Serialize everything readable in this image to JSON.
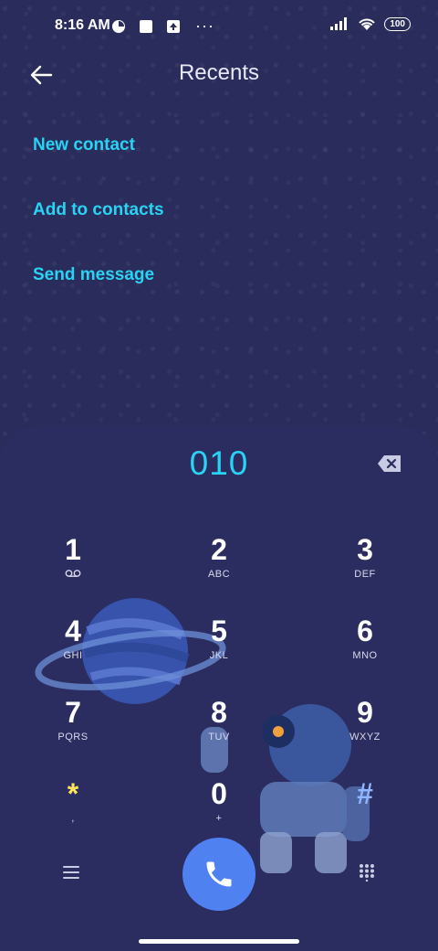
{
  "status_bar": {
    "time": "8:16 AM",
    "battery": "100"
  },
  "header": {
    "title": "Recents"
  },
  "actions": [
    {
      "label": "New contact"
    },
    {
      "label": "Add to contacts"
    },
    {
      "label": "Send message"
    }
  ],
  "dialer": {
    "number": "010",
    "keys": [
      {
        "digit": "1",
        "letters": ""
      },
      {
        "digit": "2",
        "letters": "ABC"
      },
      {
        "digit": "3",
        "letters": "DEF"
      },
      {
        "digit": "4",
        "letters": "GHI"
      },
      {
        "digit": "5",
        "letters": "JKL"
      },
      {
        "digit": "6",
        "letters": "MNO"
      },
      {
        "digit": "7",
        "letters": "PQRS"
      },
      {
        "digit": "8",
        "letters": "TUV"
      },
      {
        "digit": "9",
        "letters": "WXYZ"
      },
      {
        "digit": "*",
        "letters": ","
      },
      {
        "digit": "0",
        "letters": "+"
      },
      {
        "digit": "#",
        "letters": ""
      }
    ]
  },
  "colors": {
    "background": "#2a2c5c",
    "accent": "#29d3f3",
    "call_button": "#4f82f0"
  }
}
